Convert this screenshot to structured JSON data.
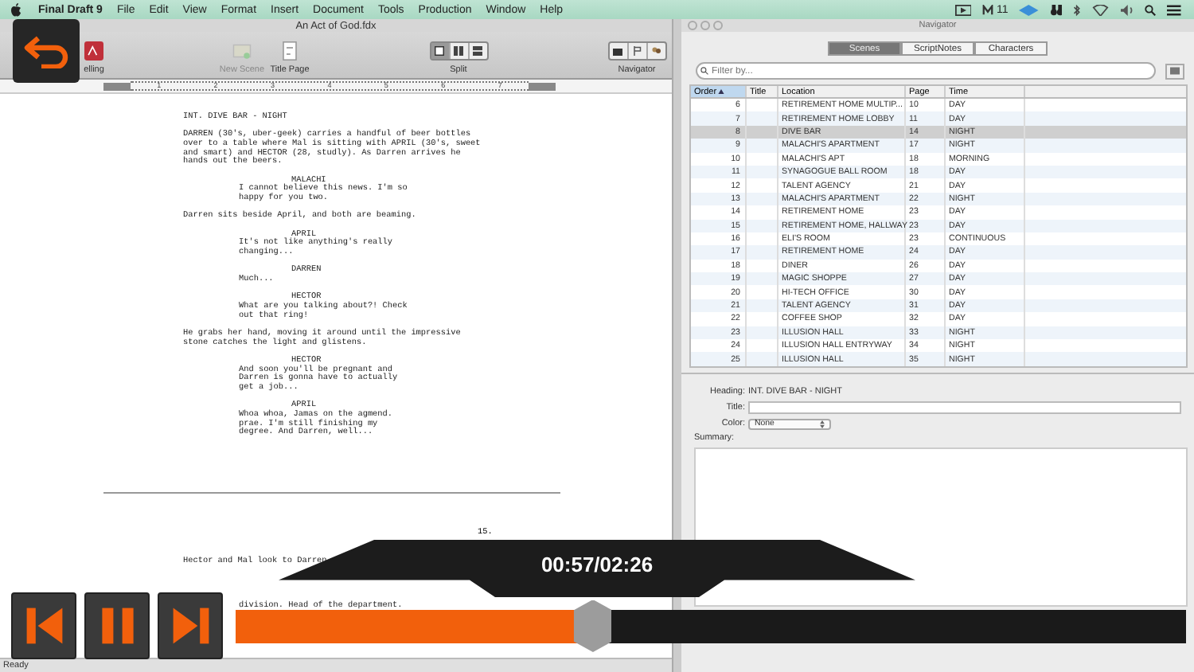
{
  "menu_bar": {
    "app_name": "Final Draft 9",
    "items": [
      "File",
      "Edit",
      "View",
      "Format",
      "Insert",
      "Document",
      "Tools",
      "Production",
      "Window",
      "Help"
    ],
    "status_text": "11"
  },
  "document_window": {
    "title": "An Act of God.fdx",
    "toolbar": [
      {
        "kind": "spelling",
        "label": "elling",
        "disabled": false
      },
      {
        "kind": "new-scene",
        "label": "New Scene",
        "disabled": true
      },
      {
        "kind": "title-page",
        "label": "Title Page",
        "disabled": false
      },
      {
        "kind": "split",
        "label": "Split",
        "disabled": false
      },
      {
        "kind": "navigator",
        "label": "Navigator",
        "disabled": false
      }
    ],
    "ruler_numbers": [
      "1",
      "2",
      "3",
      "4",
      "5",
      "6",
      "7"
    ],
    "script": [
      {
        "kind": "heading",
        "text": "INT. DIVE BAR - NIGHT"
      },
      {
        "kind": "action",
        "text": "DARREN (30's, uber-geek) carries a handful of beer bottles\nover to a table where Mal is sitting with APRIL (30's, sweet\nand smart) and HECTOR (28, studly). As Darren arrives he\nhands out the beers."
      },
      {
        "kind": "character",
        "text": "MALACHI"
      },
      {
        "kind": "dialogue",
        "text": "I cannot believe this news. I'm so\nhappy for you two."
      },
      {
        "kind": "action",
        "text": "Darren sits beside April, and both are beaming."
      },
      {
        "kind": "character",
        "text": "APRIL"
      },
      {
        "kind": "dialogue",
        "text": "It's not like anything's really\nchanging..."
      },
      {
        "kind": "character",
        "text": "DARREN"
      },
      {
        "kind": "dialogue",
        "text": "Much..."
      },
      {
        "kind": "character",
        "text": "HECTOR"
      },
      {
        "kind": "dialogue",
        "text": "What are you talking about?! Check\nout that ring!"
      },
      {
        "kind": "action",
        "text": "He grabs her hand, moving it around until the impressive\nstone catches the light and glistens."
      },
      {
        "kind": "character",
        "text": "HECTOR"
      },
      {
        "kind": "dialogue",
        "text": "And soon you'll be pregnant and\nDarren is gonna have to actually\nget a job..."
      },
      {
        "kind": "character",
        "text": "APRIL"
      },
      {
        "kind": "dialogue",
        "text": "Whoa whoa, Jamas on the agmend.\nprae. I'm still finishing my\ndegree. And Darren, well..."
      }
    ],
    "page_number": "15.",
    "next_page": [
      {
        "kind": "action",
        "text": "Hector and Mal look to Darren"
      },
      {
        "kind": "dialogue",
        "text": "division. Head of the department."
      }
    ],
    "status": "Ready"
  },
  "navigator": {
    "title": "Navigator",
    "tabs": [
      {
        "label": "Scenes",
        "selected": true
      },
      {
        "label": "ScriptNotes",
        "selected": false
      },
      {
        "label": "Characters",
        "selected": false
      }
    ],
    "filter_placeholder": "Filter by...",
    "columns": [
      {
        "label": "Order",
        "selected": true
      },
      {
        "label": "Title",
        "selected": false
      },
      {
        "label": "Location",
        "selected": false
      },
      {
        "label": "Page",
        "selected": false
      },
      {
        "label": "Time",
        "selected": false
      }
    ],
    "rows": [
      {
        "order": "6",
        "location": "RETIREMENT HOME MULTIP...",
        "page": "10",
        "time": "DAY",
        "selected": false
      },
      {
        "order": "7",
        "location": "RETIREMENT HOME LOBBY",
        "page": "11",
        "time": "DAY",
        "selected": false
      },
      {
        "order": "8",
        "location": "DIVE BAR",
        "page": "14",
        "time": "NIGHT",
        "selected": true
      },
      {
        "order": "9",
        "location": "MALACHI'S APARTMENT",
        "page": "17",
        "time": "NIGHT",
        "selected": false
      },
      {
        "order": "10",
        "location": "MALACHI'S APT",
        "page": "18",
        "time": "MORNING",
        "selected": false
      },
      {
        "order": "11",
        "location": "SYNAGOGUE BALL ROOM",
        "page": "18",
        "time": "DAY",
        "selected": false
      },
      {
        "order": "12",
        "location": "TALENT AGENCY",
        "page": "21",
        "time": "DAY",
        "selected": false
      },
      {
        "order": "13",
        "location": "MALACHI'S APARTMENT",
        "page": "22",
        "time": "NIGHT",
        "selected": false
      },
      {
        "order": "14",
        "location": "RETIREMENT HOME",
        "page": "23",
        "time": "DAY",
        "selected": false
      },
      {
        "order": "15",
        "location": "RETIREMENT HOME, HALLWAY",
        "page": "23",
        "time": "DAY",
        "selected": false
      },
      {
        "order": "16",
        "location": "ELI'S ROOM",
        "page": "23",
        "time": "CONTINUOUS",
        "selected": false
      },
      {
        "order": "17",
        "location": "RETIREMENT HOME",
        "page": "24",
        "time": "DAY",
        "selected": false
      },
      {
        "order": "18",
        "location": "DINER",
        "page": "26",
        "time": "DAY",
        "selected": false
      },
      {
        "order": "19",
        "location": "MAGIC SHOPPE",
        "page": "27",
        "time": "DAY",
        "selected": false
      },
      {
        "order": "20",
        "location": "HI-TECH OFFICE",
        "page": "30",
        "time": "DAY",
        "selected": false
      },
      {
        "order": "21",
        "location": "TALENT AGENCY",
        "page": "31",
        "time": "DAY",
        "selected": false
      },
      {
        "order": "22",
        "location": "COFFEE SHOP",
        "page": "32",
        "time": "DAY",
        "selected": false
      },
      {
        "order": "23",
        "location": "ILLUSION HALL",
        "page": "33",
        "time": "NIGHT",
        "selected": false
      },
      {
        "order": "24",
        "location": "ILLUSION HALL ENTRYWAY",
        "page": "34",
        "time": "NIGHT",
        "selected": false
      },
      {
        "order": "25",
        "location": "ILLUSION HALL",
        "page": "35",
        "time": "NIGHT",
        "selected": false
      }
    ],
    "detail": {
      "heading_label": "Heading:",
      "heading": "INT. DIVE BAR - NIGHT",
      "title_label": "Title:",
      "color_label": "Color:",
      "color_value": "None",
      "summary_label": "Summary:"
    }
  },
  "player": {
    "time": "00:57/02:26",
    "level": 0.376
  }
}
